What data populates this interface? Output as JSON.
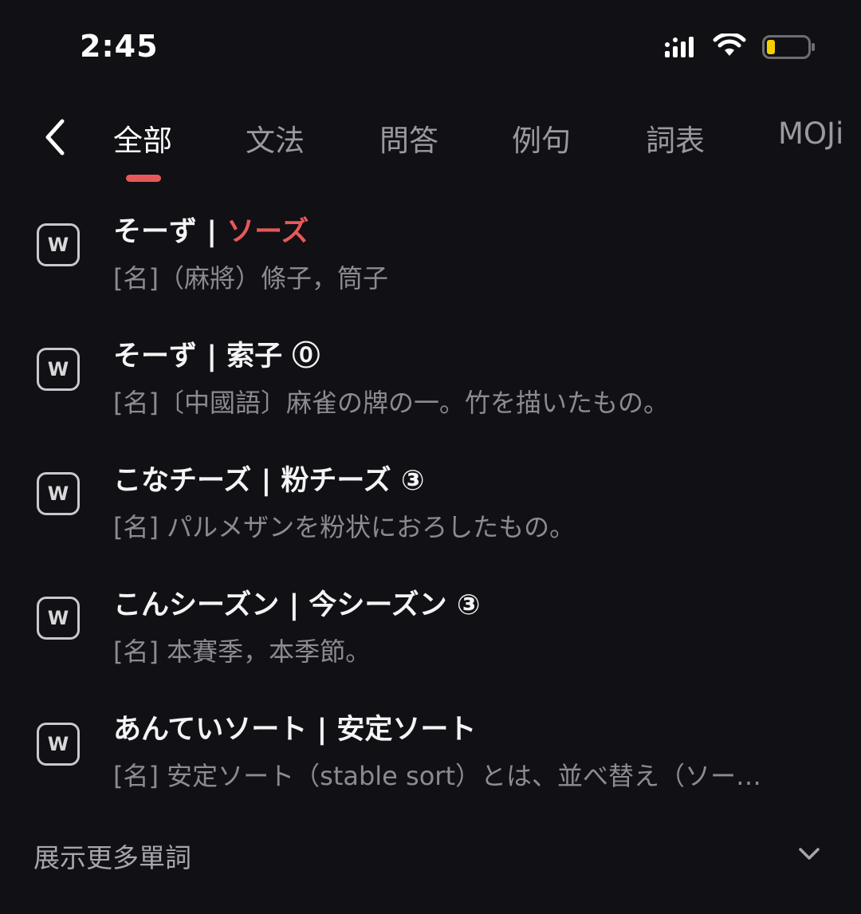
{
  "status_bar": {
    "time": "2:45",
    "signal_icon": "cellular-signal-icon",
    "wifi_icon": "wifi-icon",
    "battery_icon": "battery-low-icon",
    "battery_color": "#f5d000"
  },
  "nav": {
    "back_icon": "chevron-left-icon",
    "tabs": [
      {
        "label": "全部",
        "active": true
      },
      {
        "label": "文法",
        "active": false
      },
      {
        "label": "問答",
        "active": false
      },
      {
        "label": "例句",
        "active": false
      },
      {
        "label": "詞表",
        "active": false
      },
      {
        "label": "MOJi",
        "active": false
      }
    ],
    "accent_color": "#e8585a"
  },
  "entries": [
    {
      "badge": "W",
      "reading": "そーず",
      "separator": " | ",
      "headword": "ソーズ",
      "headword_accent": true,
      "tone": "",
      "definition": "[名]（麻將）條子，筒子"
    },
    {
      "badge": "W",
      "reading": "そーず",
      "separator": " | ",
      "headword": "索子",
      "headword_accent": false,
      "tone": " ⓪",
      "definition": "[名]〔中國語〕麻雀の牌の一。竹を描いたもの。"
    },
    {
      "badge": "W",
      "reading": "こなチーズ",
      "separator": " | ",
      "headword": "粉チーズ",
      "headword_accent": false,
      "tone": " ③",
      "definition": "[名] パルメザンを粉状におろしたもの。"
    },
    {
      "badge": "W",
      "reading": "こんシーズン",
      "separator": " | ",
      "headword": "今シーズン",
      "headword_accent": false,
      "tone": " ③",
      "definition": "[名] 本賽季，本季節。"
    },
    {
      "badge": "W",
      "reading": "あんていソート",
      "separator": " | ",
      "headword": "安定ソート",
      "headword_accent": false,
      "tone": "",
      "definition": "[名] 安定ソート（stable sort）とは、並べ替え（ソー…"
    }
  ],
  "footer": {
    "more_label": "展示更多單詞",
    "expand_icon": "chevron-down-icon"
  }
}
